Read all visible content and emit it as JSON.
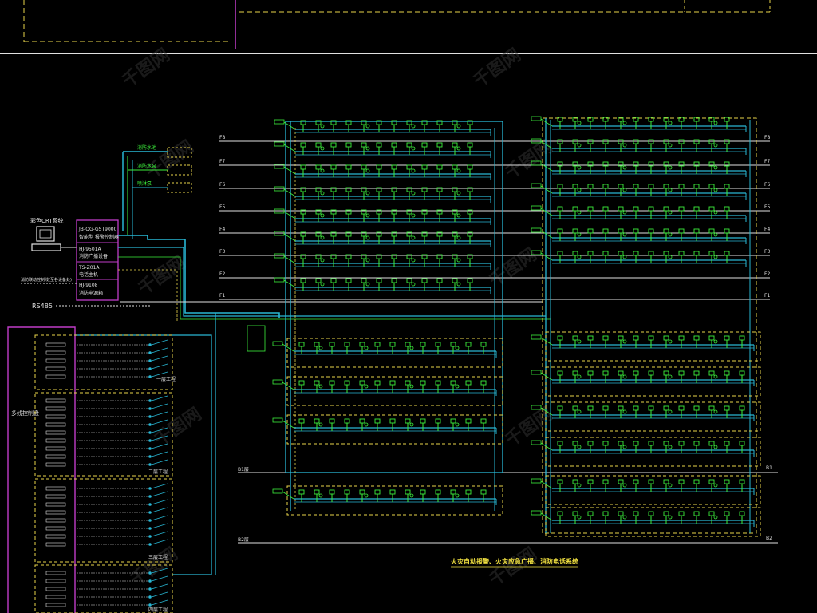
{
  "drawing": {
    "title": "火灾自动报警、火灾应急广播、消防电话系统",
    "watermark_text": "千图网"
  },
  "control_room": {
    "crt_label": "彩色CRT系统",
    "box_lines": [
      "JB-QG-GST9000",
      "智能型 报警控制器",
      "HJ-9501A",
      "消防广播设备",
      "TS-Z01A",
      "电话主机",
      "HJ-9108",
      "消防电源箱"
    ],
    "rs485_label": "RS485",
    "bus_note": "消防联动控制线(至各设备处)",
    "top_modules": [
      "消防水池",
      "消防水泵",
      "喷淋泵"
    ]
  },
  "left_panel": {
    "title": "多线控制盘",
    "groups": [
      {
        "label": "一层工程"
      },
      {
        "label": "二层工程"
      },
      {
        "label": "三层工程"
      },
      {
        "label": "四层工程"
      }
    ]
  },
  "floors_upper": [
    "F8",
    "F7",
    "F6",
    "F5",
    "F4",
    "F3",
    "F2",
    "F1"
  ],
  "floors_lower": [
    "B1",
    "B2"
  ],
  "bus_labels": {
    "b1": "B1层",
    "b2": "B2层"
  },
  "colors": {
    "background": "#000000",
    "bus_cyan": "#29b7d4",
    "device_green": "#3cf03c",
    "dashed_yellow": "#e8d34a",
    "magenta": "#c03cc8",
    "white_line": "#e0e0e0",
    "title_yellow": "#f0e040"
  }
}
